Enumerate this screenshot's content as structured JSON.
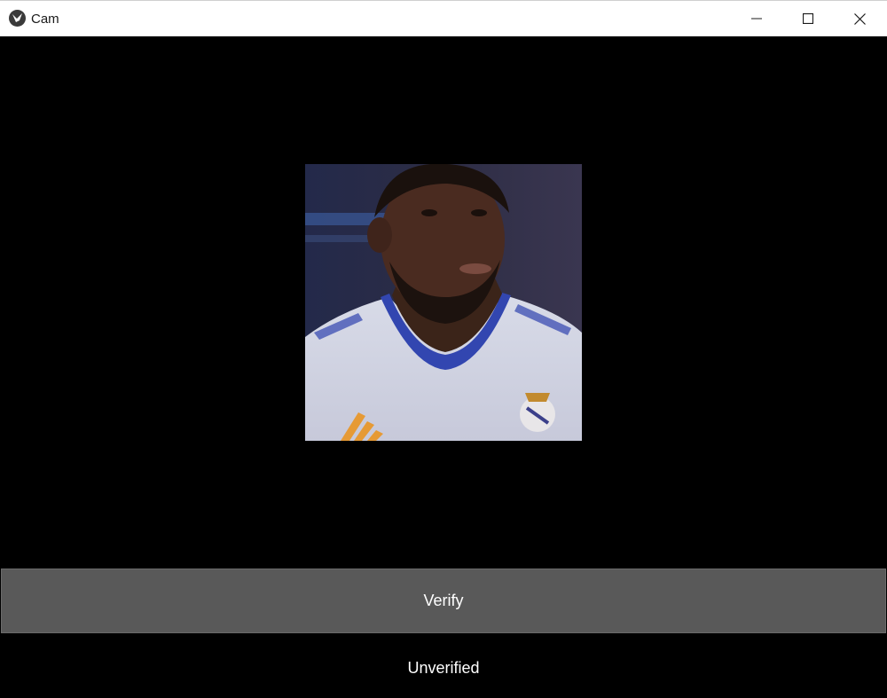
{
  "window": {
    "title": "Cam",
    "app_icon": "kivy-logo-icon",
    "controls": {
      "minimize_icon": "minimize-icon",
      "maximize_icon": "maximize-icon",
      "close_icon": "close-icon"
    }
  },
  "camera": {
    "feed_description_icon": "webcam-feed-image"
  },
  "verify_button": {
    "label": "Verify"
  },
  "status": {
    "text": "Unverified"
  },
  "colors": {
    "background": "#000000",
    "button": "#595959",
    "text": "#ffffff",
    "titlebar": "#ffffff"
  }
}
